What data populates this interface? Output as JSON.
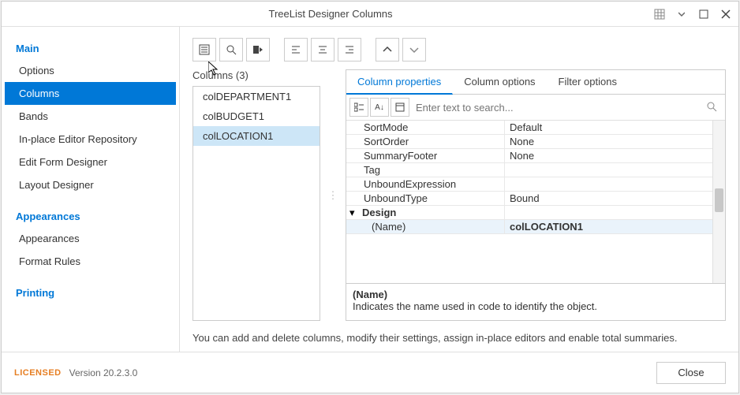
{
  "window": {
    "title": "TreeList Designer Columns"
  },
  "sidebar": {
    "sections": [
      {
        "header": "Main",
        "items": [
          {
            "label": "Options",
            "selected": false
          },
          {
            "label": "Columns",
            "selected": true
          },
          {
            "label": "Bands",
            "selected": false
          },
          {
            "label": "In-place Editor Repository",
            "selected": false
          },
          {
            "label": "Edit Form Designer",
            "selected": false
          },
          {
            "label": "Layout Designer",
            "selected": false
          }
        ]
      },
      {
        "header": "Appearances",
        "items": [
          {
            "label": "Appearances",
            "selected": false
          },
          {
            "label": "Format Rules",
            "selected": false
          }
        ]
      },
      {
        "header": "Printing",
        "items": []
      }
    ]
  },
  "columnsPanel": {
    "label": "Columns (3)",
    "items": [
      {
        "name": "colDEPARTMENT1",
        "selected": false
      },
      {
        "name": "colBUDGET1",
        "selected": false
      },
      {
        "name": "colLOCATION1",
        "selected": true
      }
    ]
  },
  "tabs": [
    {
      "label": "Column properties",
      "active": true
    },
    {
      "label": "Column options",
      "active": false
    },
    {
      "label": "Filter options",
      "active": false
    }
  ],
  "search": {
    "placeholder": "Enter text to search..."
  },
  "propertyRows": [
    {
      "name": "SortMode",
      "value": "Default"
    },
    {
      "name": "SortOrder",
      "value": "None"
    },
    {
      "name": "SummaryFooter",
      "value": "None"
    },
    {
      "name": "Tag",
      "value": ""
    },
    {
      "name": "UnboundExpression",
      "value": ""
    },
    {
      "name": "UnboundType",
      "value": "Bound"
    }
  ],
  "categoryRow": {
    "name": "Design"
  },
  "selectedRow": {
    "name": "(Name)",
    "value": "colLOCATION1"
  },
  "description": {
    "title": "(Name)",
    "text": "Indicates the name used in code to identify the object."
  },
  "hint": "You can add and delete columns, modify their settings, assign in-place editors and enable total summaries.",
  "footer": {
    "licensed": "LICENSED",
    "version": "Version 20.2.3.0",
    "close": "Close"
  }
}
